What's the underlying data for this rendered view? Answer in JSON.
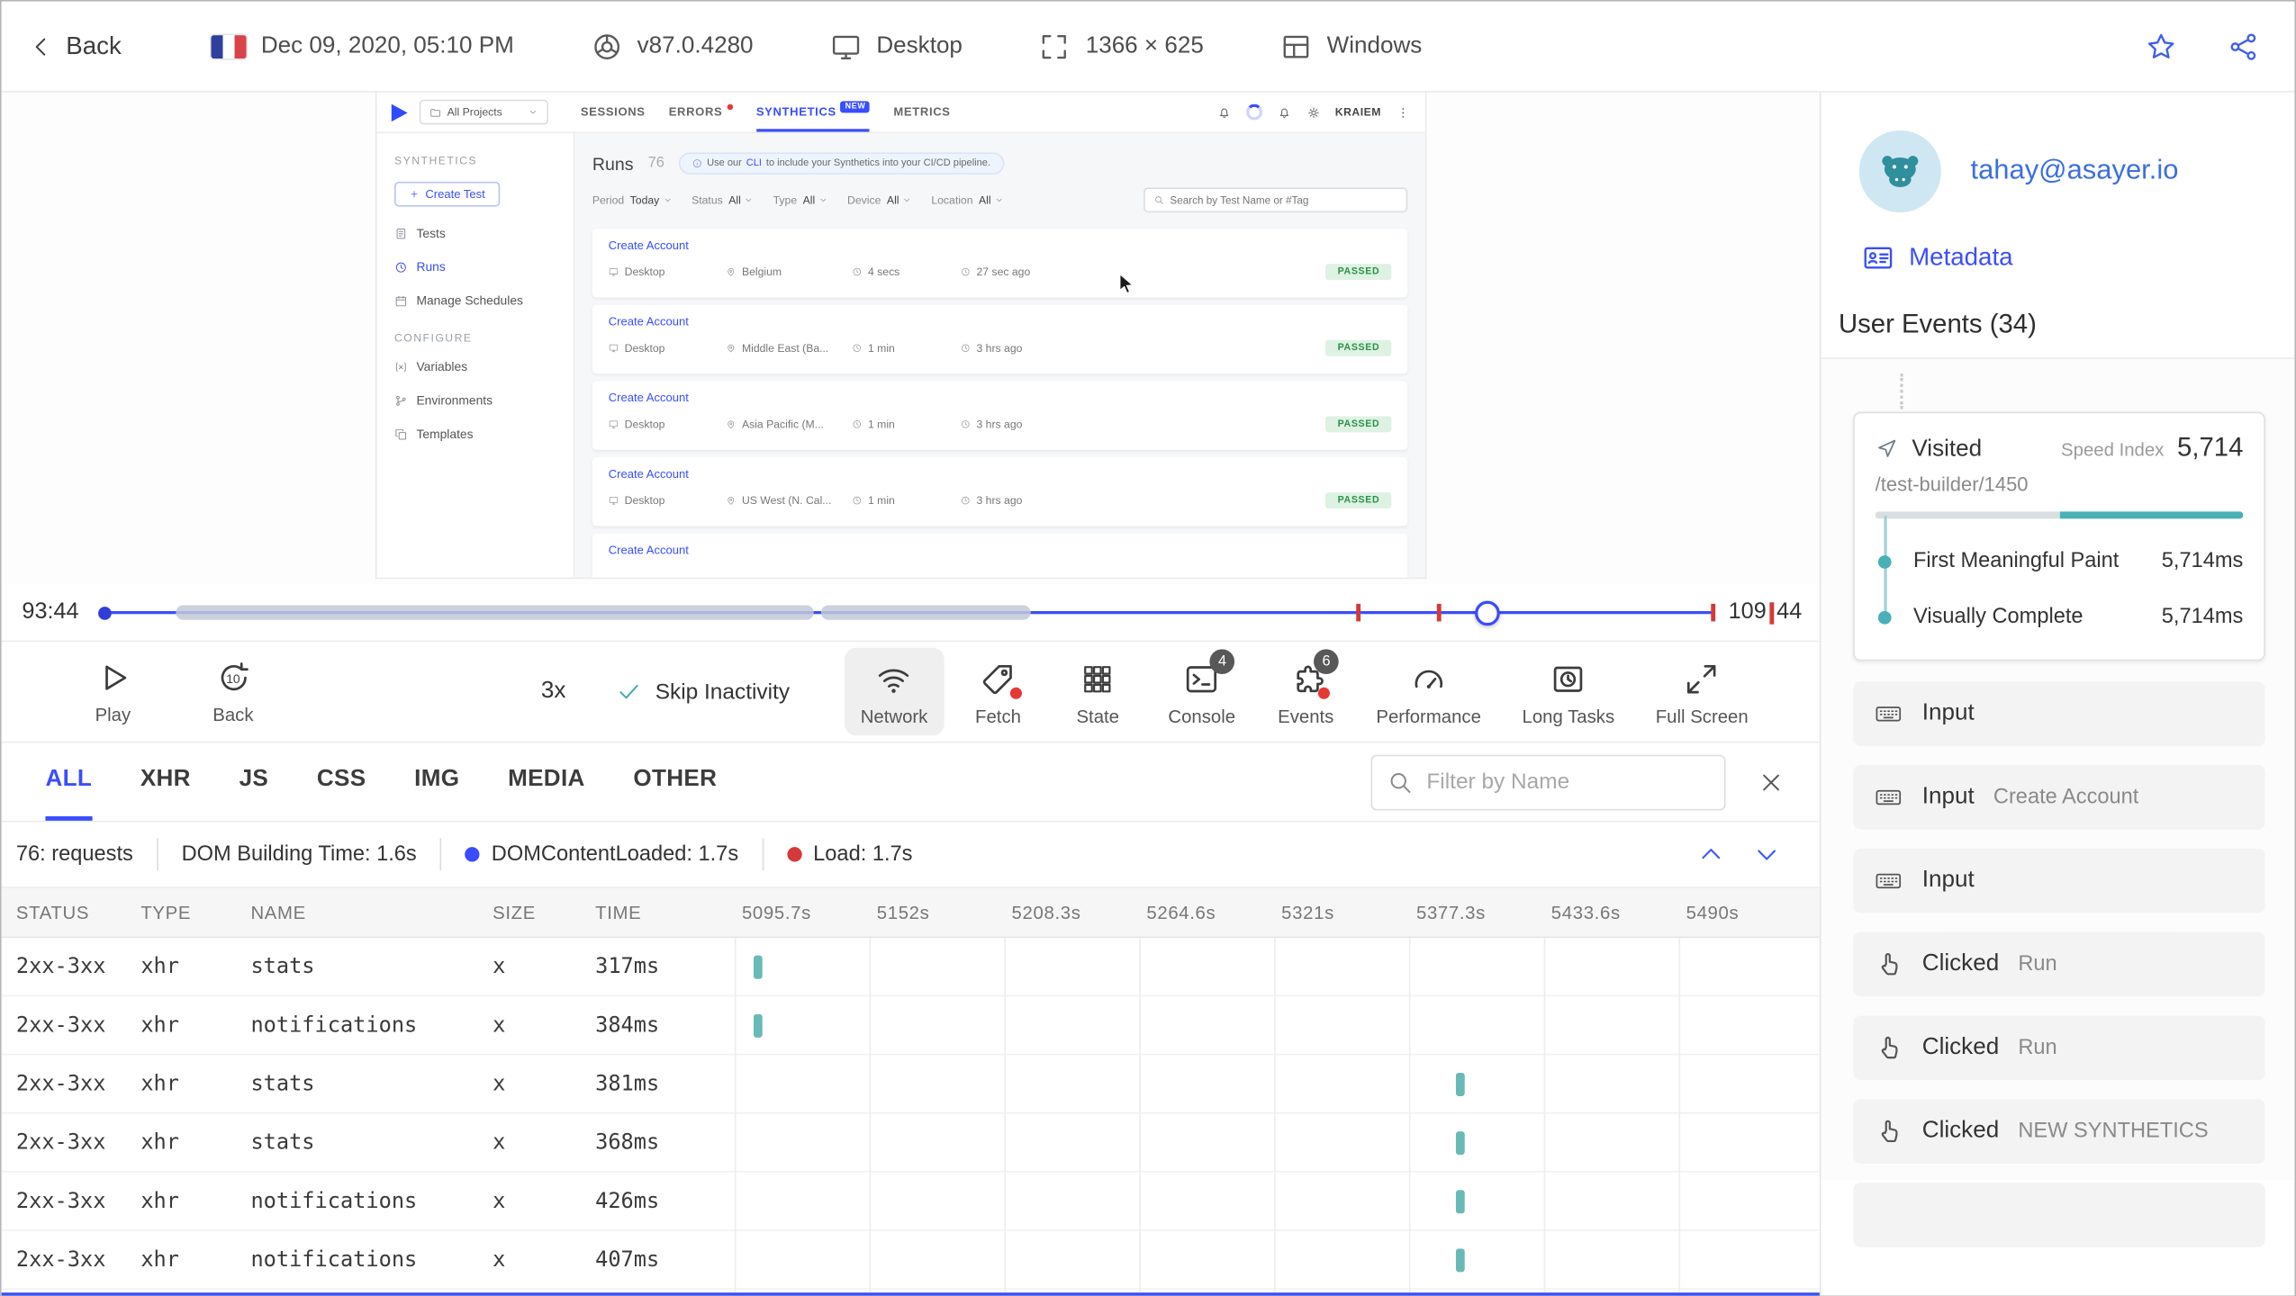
{
  "colors": {
    "accent_blue": "#394eff",
    "teal": "#3eaaaf",
    "marker_red": "#d43a3a",
    "passed_green": "#2b9147"
  },
  "top_bar": {
    "back_label": "Back",
    "timestamp": "Dec 09, 2020, 05:10 PM",
    "browser_version": "v87.0.4280",
    "device": "Desktop",
    "resolution": "1366 × 625",
    "os": "Windows"
  },
  "replay_app": {
    "project_selector": "All Projects",
    "nav_tabs": [
      {
        "label": "SESSIONS"
      },
      {
        "label": "ERRORS",
        "dot": true
      },
      {
        "label": "SYNTHETICS",
        "badge": "NEW",
        "active": true
      },
      {
        "label": "METRICS"
      }
    ],
    "user_name": "KRAIEM",
    "sidebar": {
      "section_synthetics": "SYNTHETICS",
      "create_test_label": "Create Test",
      "items": [
        {
          "label": "Tests",
          "icon": "tests"
        },
        {
          "label": "Runs",
          "icon": "runs",
          "active": true
        },
        {
          "label": "Manage Schedules",
          "icon": "schedules"
        }
      ],
      "section_configure": "CONFIGURE",
      "config_items": [
        {
          "label": "Variables",
          "icon": "variables"
        },
        {
          "label": "Environments",
          "icon": "environments"
        },
        {
          "label": "Templates",
          "icon": "templates"
        }
      ]
    },
    "content": {
      "title": "Runs",
      "count": "76",
      "banner_prefix": "Use our",
      "banner_link": "CLI",
      "banner_suffix": "to include your Synthetics into your CI/CD pipeline.",
      "filters": [
        {
          "label": "Period",
          "value": "Today"
        },
        {
          "label": "Status",
          "value": "All"
        },
        {
          "label": "Type",
          "value": "All"
        },
        {
          "label": "Device",
          "value": "All"
        },
        {
          "label": "Location",
          "value": "All"
        }
      ],
      "search_placeholder": "Search by Test Name or #Tag",
      "runs": [
        {
          "name": "Create Account",
          "device": "Desktop",
          "location": "Belgium",
          "duration": "4 secs",
          "when": "27 sec ago",
          "status": "PASSED"
        },
        {
          "name": "Create Account",
          "device": "Desktop",
          "location": "Middle East (Ba...",
          "duration": "1 min",
          "when": "3 hrs ago",
          "status": "PASSED"
        },
        {
          "name": "Create Account",
          "device": "Desktop",
          "location": "Asia Pacific (M...",
          "duration": "1 min",
          "when": "3 hrs ago",
          "status": "PASSED"
        },
        {
          "name": "Create Account",
          "device": "Desktop",
          "location": "US West (N. Cal...",
          "duration": "1 min",
          "when": "3 hrs ago",
          "status": "PASSED"
        },
        {
          "name": "Create Account",
          "device": "",
          "location": "",
          "duration": "",
          "when": "",
          "status": ""
        }
      ]
    }
  },
  "timeline": {
    "start": "93:44",
    "end_min": "109",
    "end_sec": "44",
    "progress_pct": 86,
    "inactivity_segments": [
      {
        "start_pct": 4.6,
        "end_pct": 44.2
      },
      {
        "start_pct": 44.6,
        "end_pct": 57.6
      }
    ],
    "event_markers_pct": [
      77.8,
      82.8,
      99.8
    ]
  },
  "controls": {
    "play_label": "Play",
    "back_label": "Back",
    "back_badge": "10",
    "speed": "3x",
    "skip_inactivity_label": "Skip Inactivity",
    "buttons": [
      {
        "label": "Network",
        "icon": "wifi",
        "active": true
      },
      {
        "label": "Fetch",
        "icon": "fetch",
        "dot": true
      },
      {
        "label": "State",
        "icon": "state"
      },
      {
        "label": "Console",
        "icon": "console",
        "badge": "4"
      },
      {
        "label": "Events",
        "icon": "events",
        "badge": "6",
        "dot": true
      },
      {
        "label": "Performance",
        "icon": "performance"
      },
      {
        "label": "Long Tasks",
        "icon": "longtasks"
      },
      {
        "label": "Full Screen",
        "icon": "fullscreen"
      }
    ]
  },
  "network_panel": {
    "tabs": [
      "ALL",
      "XHR",
      "JS",
      "CSS",
      "IMG",
      "MEDIA",
      "OTHER"
    ],
    "active_tab": "ALL",
    "filter_placeholder": "Filter by Name",
    "summary": {
      "requests": "76: requests",
      "dom_building": "DOM Building Time: 1.6s",
      "dom_content_loaded": "DOMContentLoaded: 1.7s",
      "load": "Load: 1.7s"
    },
    "columns": [
      "STATUS",
      "TYPE",
      "NAME",
      "SIZE",
      "TIME"
    ],
    "time_columns": [
      "5095.7s",
      "5152s",
      "5208.3s",
      "5264.6s",
      "5321s",
      "5377.3s",
      "5433.6s",
      "5490s"
    ],
    "rows": [
      {
        "status": "2xx-3xx",
        "type": "xhr",
        "name": "stats",
        "size": "x",
        "time": "317ms",
        "bar_pct": 1.8
      },
      {
        "status": "2xx-3xx",
        "type": "xhr",
        "name": "notifications",
        "size": "x",
        "time": "384ms",
        "bar_pct": 1.8
      },
      {
        "status": "2xx-3xx",
        "type": "xhr",
        "name": "stats",
        "size": "x",
        "time": "381ms",
        "bar_pct": 66.5
      },
      {
        "status": "2xx-3xx",
        "type": "xhr",
        "name": "stats",
        "size": "x",
        "time": "368ms",
        "bar_pct": 66.5
      },
      {
        "status": "2xx-3xx",
        "type": "xhr",
        "name": "notifications",
        "size": "x",
        "time": "426ms",
        "bar_pct": 66.5
      },
      {
        "status": "2xx-3xx",
        "type": "xhr",
        "name": "notifications",
        "size": "x",
        "time": "407ms",
        "bar_pct": 66.5
      }
    ]
  },
  "user_panel": {
    "email": "tahay@asayer.io",
    "metadata_label": "Metadata",
    "events_title": "User Events (34)",
    "visited_card": {
      "label": "Visited",
      "speed_index_label": "Speed Index",
      "speed_index_value": "5,714",
      "url": "/test-builder/1450",
      "metrics": [
        {
          "label": "First Meaningful Paint",
          "value": "5,714ms"
        },
        {
          "label": "Visually Complete",
          "value": "5,714ms"
        }
      ]
    },
    "events": [
      {
        "type": "input",
        "label": "Input",
        "value": ""
      },
      {
        "type": "input",
        "label": "Input",
        "value": "Create Account"
      },
      {
        "type": "input",
        "label": "Input",
        "value": ""
      },
      {
        "type": "click",
        "label": "Clicked",
        "value": "Run"
      },
      {
        "type": "click",
        "label": "Clicked",
        "value": "Run"
      },
      {
        "type": "click",
        "label": "Clicked",
        "value": "NEW SYNTHETICS"
      }
    ]
  }
}
